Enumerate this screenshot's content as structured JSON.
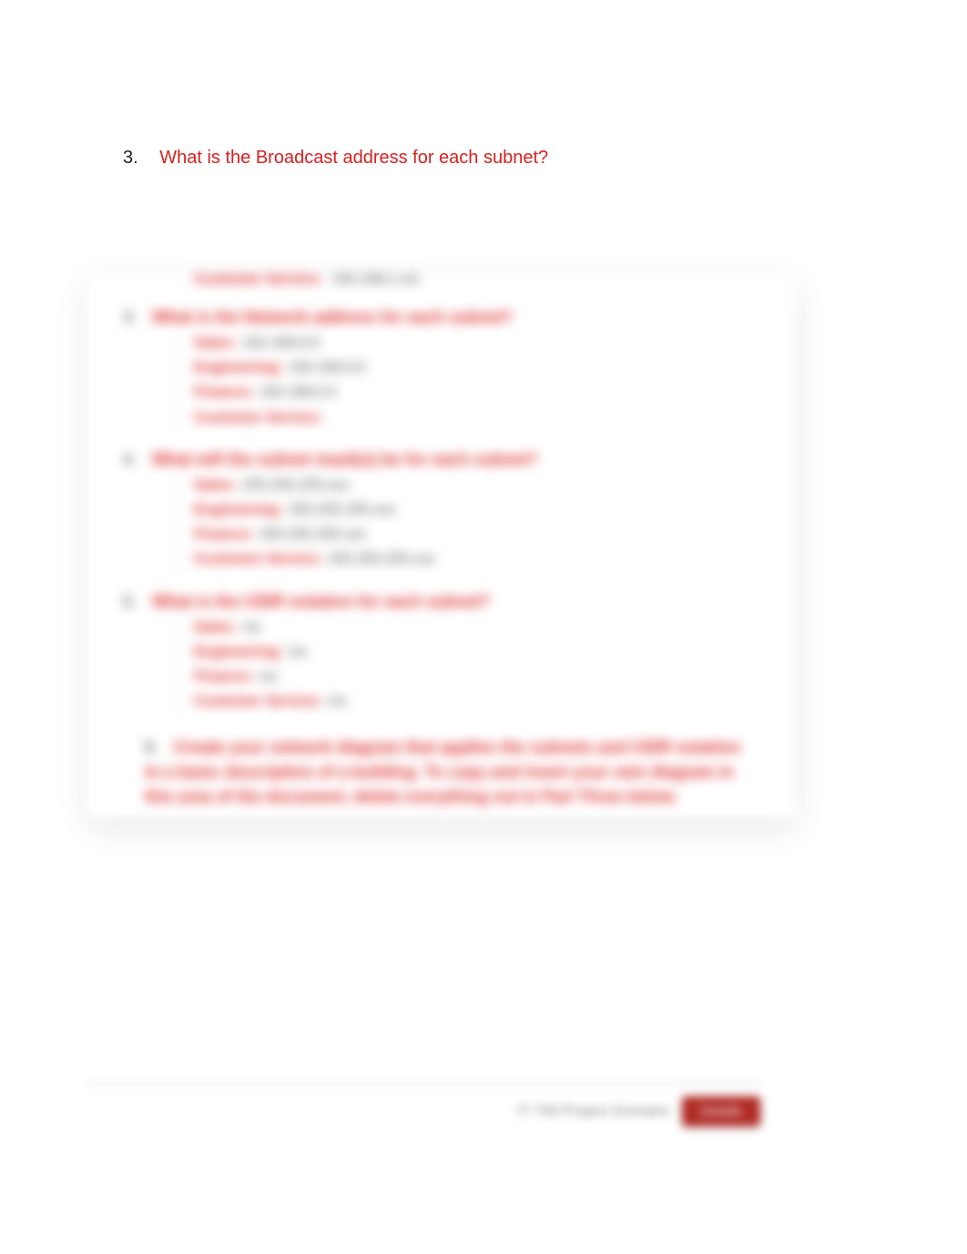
{
  "visible_question": {
    "number": "3.",
    "text": "What is the Broadcast address for each subnet?"
  },
  "blurred": {
    "top_row": {
      "label": "Customer Service:",
      "value": "192.168.1.x/x"
    },
    "q2": {
      "number": "3.",
      "title": "What is the Network address for each subnet?",
      "items": [
        {
          "label": "Sales:",
          "value": "192.168.0.0"
        },
        {
          "label": "Engineering:",
          "value": "192.168.0.0"
        },
        {
          "label": "Finance:",
          "value": "192.168.0.0"
        },
        {
          "label": "Customer Service:",
          "value": ""
        }
      ]
    },
    "q3": {
      "number": "4.",
      "title": "What will the subnet mask(s) be for each subnet?",
      "items": [
        {
          "label": "Sales:",
          "value": "255.255.255.xxx"
        },
        {
          "label": "Engineering:",
          "value": "255.255.255.xxx"
        },
        {
          "label": "Finance:",
          "value": "255.255.255.xxx"
        },
        {
          "label": "Customer Service:",
          "value": "255.255.255.xxx"
        }
      ]
    },
    "q4": {
      "number": "5.",
      "title": "What is the CIDR notation for each subnet?",
      "items": [
        {
          "label": "Sales:",
          "value": "/xx"
        },
        {
          "label": "Engineering:",
          "value": "/xx"
        },
        {
          "label": "Finance:",
          "value": "/xx"
        },
        {
          "label": "Customer Service:",
          "value": "/xx"
        }
      ]
    },
    "q5": {
      "number": "6.",
      "paragraph": "Create your network diagram that applies the subnets and CIDR notation to a basic description of a building. To copy and insert your own diagram in this area of the document, delete everything out in Part Three below."
    }
  },
  "footer": {
    "left": "IT 700 Project Scenario",
    "button": "Details"
  }
}
